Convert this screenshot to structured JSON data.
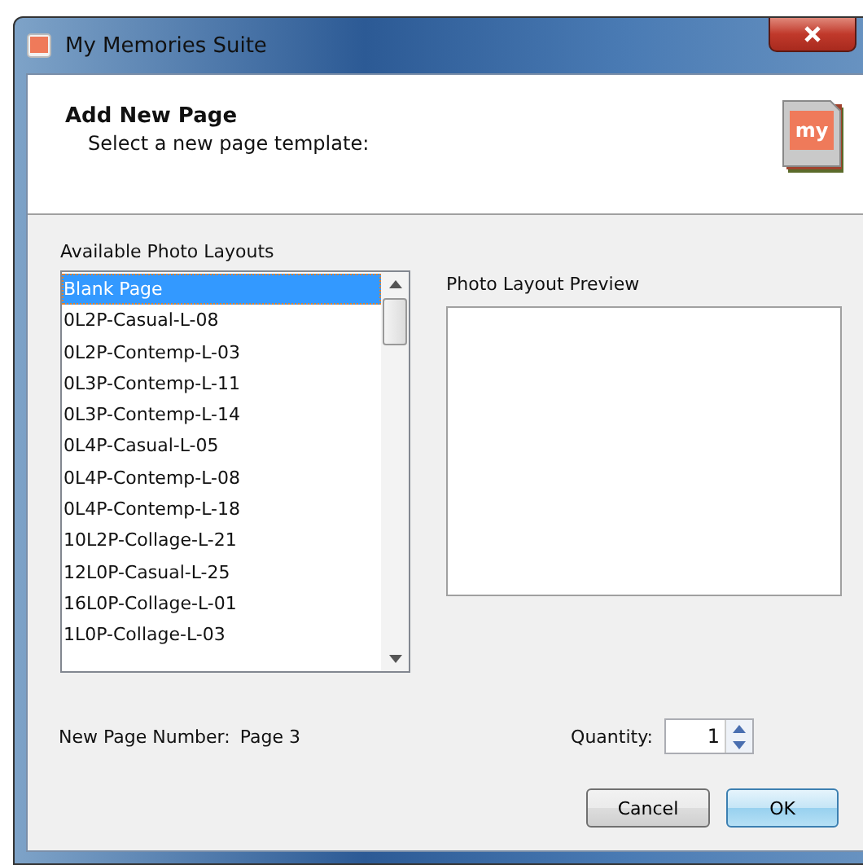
{
  "window": {
    "title": "My Memories Suite"
  },
  "header": {
    "title": "Add New Page",
    "subtitle": "Select a new page template:",
    "logo_text": "my"
  },
  "layouts": {
    "label": "Available Photo Layouts",
    "items": [
      {
        "label": "Blank Page",
        "selected": true
      },
      {
        "label": "0L2P-Casual-L-08",
        "selected": false
      },
      {
        "label": "0L2P-Contemp-L-03",
        "selected": false
      },
      {
        "label": "0L3P-Contemp-L-11",
        "selected": false
      },
      {
        "label": "0L3P-Contemp-L-14",
        "selected": false
      },
      {
        "label": "0L4P-Casual-L-05",
        "selected": false
      },
      {
        "label": "0L4P-Contemp-L-08",
        "selected": false
      },
      {
        "label": "0L4P-Contemp-L-18",
        "selected": false
      },
      {
        "label": "10L2P-Collage-L-21",
        "selected": false
      },
      {
        "label": "12L0P-Casual-L-25",
        "selected": false
      },
      {
        "label": "16L0P-Collage-L-01",
        "selected": false
      },
      {
        "label": "1L0P-Collage-L-03",
        "selected": false
      }
    ]
  },
  "preview": {
    "label": "Photo Layout Preview"
  },
  "page_number": {
    "label": "New Page Number:",
    "value": "Page 3"
  },
  "quantity": {
    "label": "Quantity:",
    "value": "1"
  },
  "buttons": [
    {
      "label": "Cancel",
      "kind": "normal"
    },
    {
      "label": "OK",
      "kind": "default"
    }
  ]
}
